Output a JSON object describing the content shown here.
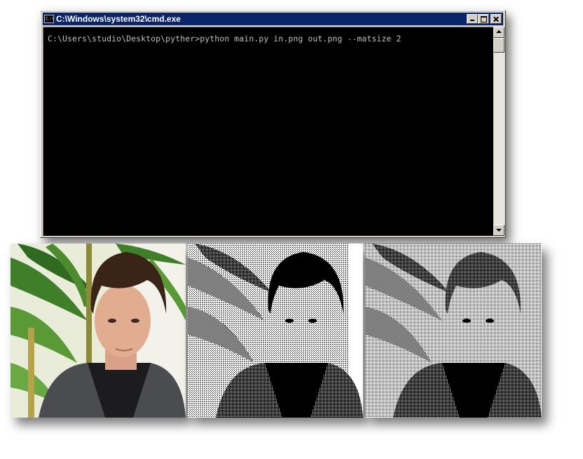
{
  "window": {
    "title": "C:\\Windows\\system32\\cmd.exe",
    "icon_label": "C:\\",
    "buttons": {
      "minimize_icon": "minimize-icon",
      "maximize_icon": "maximize-icon",
      "close_icon": "close-icon"
    }
  },
  "console": {
    "command_line": "C:\\Users\\studio\\Desktop\\pyther>python main.py in.png out.png --matsize 2",
    "background": "#000000",
    "foreground": "#c0c0c0"
  },
  "images": [
    {
      "kind": "photo",
      "description_icon": "portrait-photo"
    },
    {
      "kind": "dithered",
      "description_icon": "dithered-portrait-1"
    },
    {
      "kind": "dithered",
      "description_icon": "dithered-portrait-2"
    }
  ],
  "colors": {
    "titlebar": "#0a246a",
    "chrome": "#d4d0c8"
  }
}
